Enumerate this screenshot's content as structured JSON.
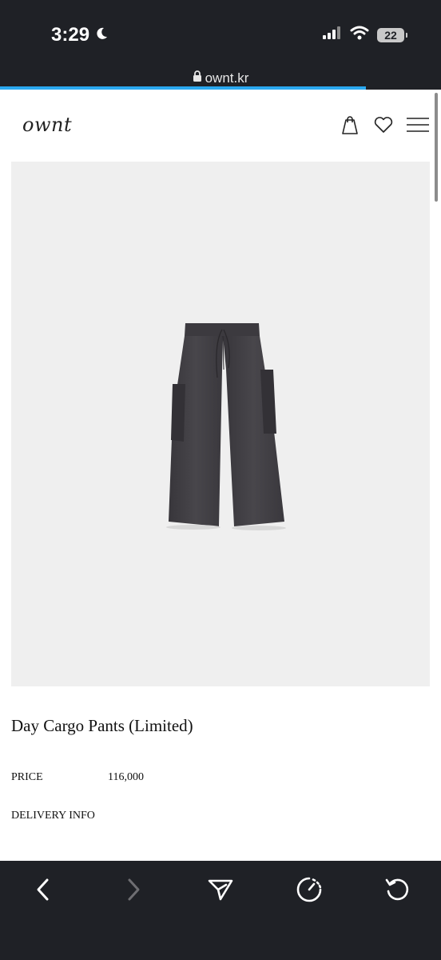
{
  "status_bar": {
    "time": "3:29",
    "battery_level": "22"
  },
  "browser": {
    "url": "ownt.kr",
    "load_progress": 0.83
  },
  "site": {
    "logo": "ownt"
  },
  "product": {
    "title": "Day Cargo Pants (Limited)",
    "price_label": "PRICE",
    "price": "116,000",
    "delivery_label": "DELIVERY INFO"
  },
  "icons": {
    "moon": "moon-icon",
    "signal": "cellular-signal-icon",
    "wifi": "wifi-icon",
    "lock": "lock-icon",
    "bag": "shopping-bag-icon",
    "heart": "heart-icon",
    "menu": "hamburger-menu-icon",
    "back": "back-arrow-icon",
    "forward": "forward-arrow-icon",
    "share": "share-send-icon",
    "speed": "speed-timer-icon",
    "reload": "reload-icon"
  },
  "colors": {
    "chrome": "#1f2126",
    "progress": "#2aa8f0",
    "image_bg": "#efefef"
  }
}
